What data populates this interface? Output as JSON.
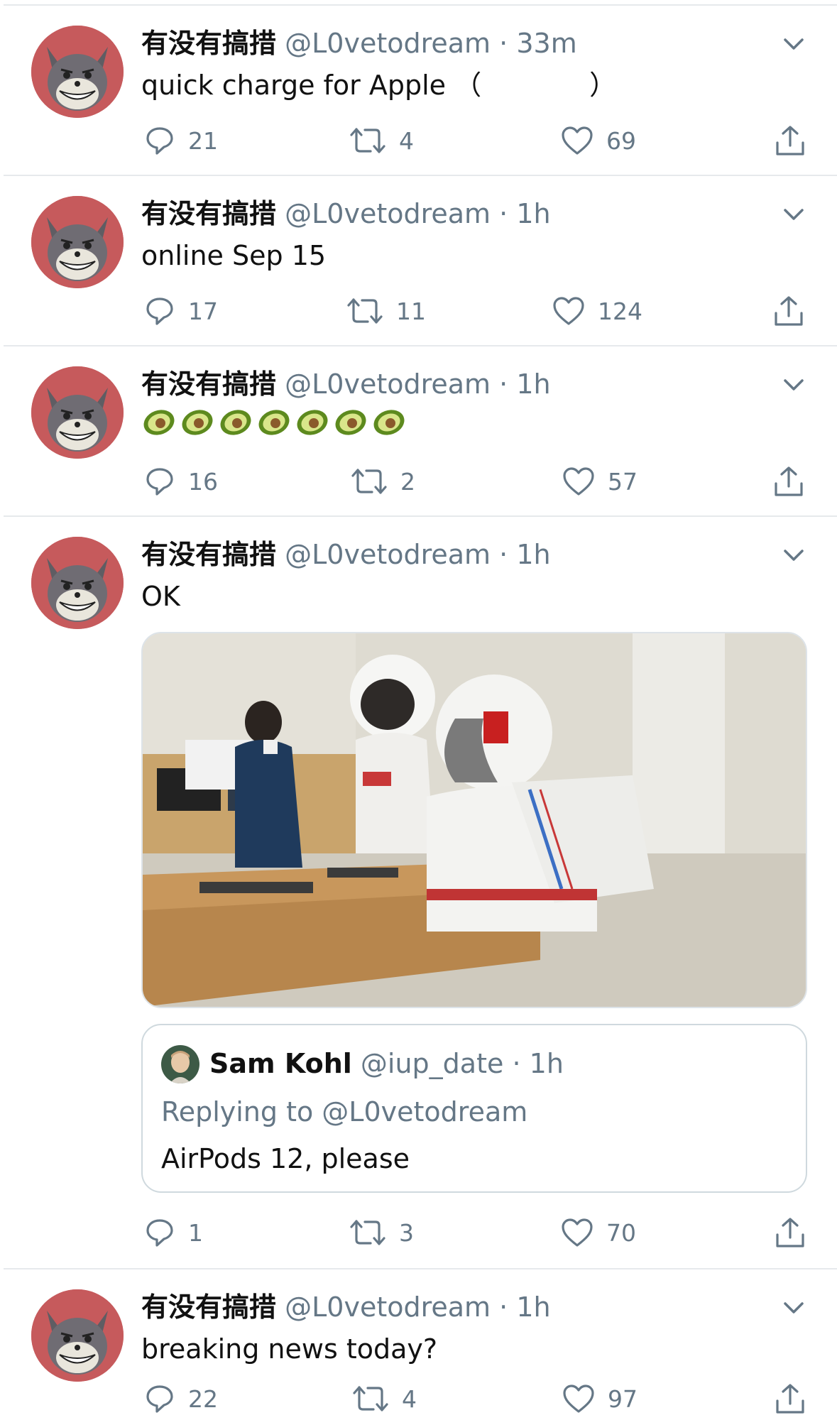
{
  "tweets": [
    {
      "name": "有没有搞措",
      "handle": "@L0vetodream",
      "dot": "·",
      "time": "33m",
      "text": "quick charge for Apple （　　　　）",
      "replies": "21",
      "retweets": "4",
      "likes": "69"
    },
    {
      "name": "有没有搞措",
      "handle": "@L0vetodream",
      "dot": "·",
      "time": "1h",
      "text": "online Sep 15",
      "replies": "17",
      "retweets": "11",
      "likes": "124"
    },
    {
      "name": "有没有搞措",
      "handle": "@L0vetodream",
      "dot": "·",
      "time": "1h",
      "emoji_count": 7,
      "emoji_icon": "avocado-emoji",
      "replies": "16",
      "retweets": "2",
      "likes": "57"
    },
    {
      "name": "有没有搞措",
      "handle": "@L0vetodream",
      "dot": "·",
      "time": "1h",
      "text": "OK",
      "media_icon": "apple-store-astronauts-photo",
      "quote": {
        "name": "Sam Kohl",
        "handle": "@iup_date",
        "dot": "·",
        "time": "1h",
        "replying": "Replying to @L0vetodream",
        "text": "AirPods 12, please"
      },
      "replies": "1",
      "retweets": "3",
      "likes": "70"
    },
    {
      "name": "有没有搞措",
      "handle": "@L0vetodream",
      "dot": "·",
      "time": "1h",
      "text": "breaking news today?",
      "replies": "22",
      "retweets": "4",
      "likes": "97"
    }
  ],
  "icons": {
    "reply": "reply-icon",
    "retweet": "retweet-icon",
    "like": "like-icon",
    "share": "share-icon",
    "more": "chevron-down-icon",
    "avatar": "cartoon-cat-avatar"
  },
  "colors": {
    "text": "#111111",
    "secondary": "#657786",
    "separator": "#e6e9ec",
    "avatar_bg": "#c65a5c",
    "avocado_skin": "#5d8a1e",
    "avocado_flesh": "#d9e68a",
    "avocado_pit": "#8a5a2b"
  }
}
